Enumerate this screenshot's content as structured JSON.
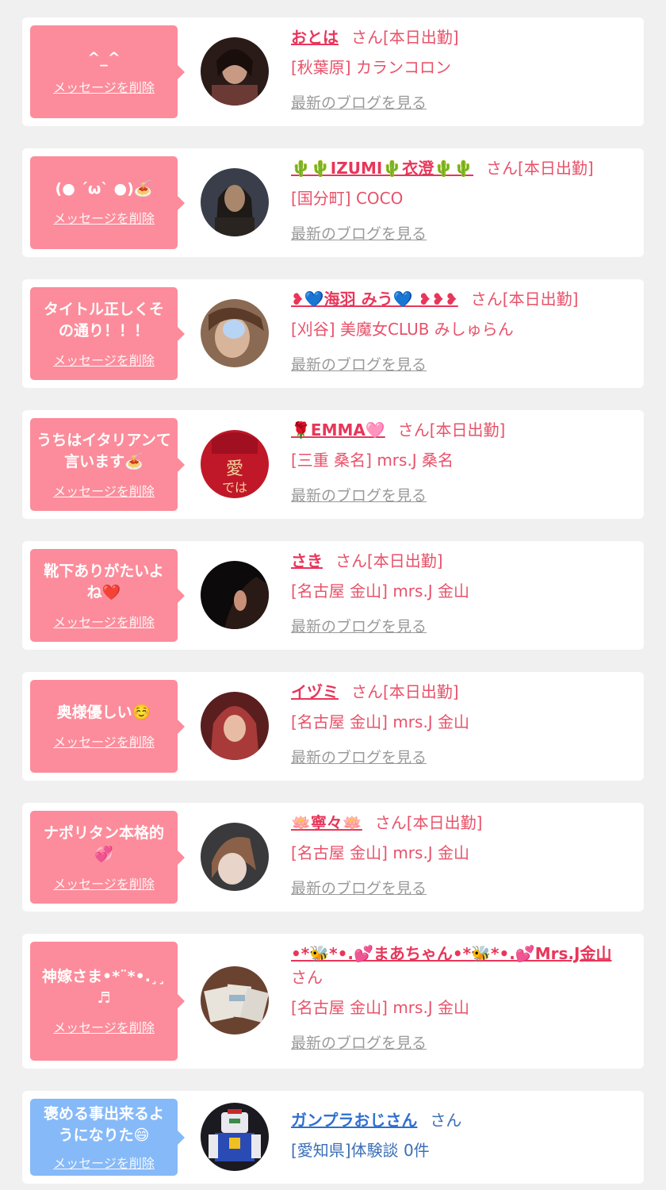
{
  "items": [
    {
      "message": "^_^",
      "delete_label": "メッセージを削除",
      "name": "おとは",
      "suffix": "さん[本日出勤]",
      "shop": "[秋葉原] カランコロン",
      "blog_label": "最新のブログを見る",
      "bubble_color": "#fc8c9b",
      "avatar_colors": [
        "#2a1a18",
        "#c89a84",
        "#6b3a34"
      ]
    },
    {
      "message": "(● ´ω` ●)🍝",
      "delete_label": "メッセージを削除",
      "name": "🌵🌵IZUMI🌵衣澄🌵🌵",
      "suffix": "さん[本日出勤]",
      "shop": "[国分町] COCO",
      "blog_label": "最新のブログを見る",
      "bubble_color": "#fc8c9b",
      "avatar_colors": [
        "#3a3e4a",
        "#a8876c",
        "#1e1a18"
      ]
    },
    {
      "message": "タイトル正しくその通り！！！",
      "delete_label": "メッセージを削除",
      "name": "❥💙海羽 みう💙 ❥❥❥",
      "suffix": "さん[本日出勤]",
      "shop": "[刈谷] 美魔女CLUB みしゅらん",
      "blog_label": "最新のブログを見る",
      "bubble_color": "#fc8c9b",
      "avatar_colors": [
        "#8a6a52",
        "#d8b49a",
        "#b8d4f4"
      ]
    },
    {
      "message": "うちはイタリアンて言います🍝",
      "delete_label": "メッセージを削除",
      "name": "🌹EMMA🩷",
      "suffix": "さん[本日出勤]",
      "shop": "[三重 桑名] mrs.J 桑名",
      "blog_label": "最新のブログを見る",
      "bubble_color": "#fc8c9b",
      "avatar_colors": [
        "#c01828",
        "#e84848",
        "#f4d0a0"
      ]
    },
    {
      "message": "靴下ありがたいよね❤️",
      "delete_label": "メッセージを削除",
      "name": "さき",
      "suffix": "さん[本日出勤]",
      "shop": "[名古屋 金山] mrs.J 金山",
      "blog_label": "最新のブログを見る",
      "bubble_color": "#fc8c9b",
      "avatar_colors": [
        "#0c0a0a",
        "#c89078",
        "#2a1a16"
      ]
    },
    {
      "message": "奥様優しい☺️",
      "delete_label": "メッセージを削除",
      "name": "イヅミ",
      "suffix": "さん[本日出勤]",
      "shop": "[名古屋 金山] mrs.J 金山",
      "blog_label": "最新のブログを見る",
      "bubble_color": "#fc8c9b",
      "avatar_colors": [
        "#5a1e1e",
        "#e8bca4",
        "#a83a3a"
      ]
    },
    {
      "message": "ナポリタン本格的💞",
      "delete_label": "メッセージを削除",
      "name": "🪷寧々🪷",
      "suffix": "さん[本日出勤]",
      "shop": "[名古屋 金山] mrs.J 金山",
      "blog_label": "最新のブログを見る",
      "bubble_color": "#fc8c9b",
      "avatar_colors": [
        "#3a3a3c",
        "#e8d4c8",
        "#8a6048"
      ]
    },
    {
      "message": "神嫁さま•*¨*•.¸¸♬",
      "delete_label": "メッセージを削除",
      "name": "•*🐝*•.💕まあちゃん•*🐝*•.💕Mrs.J金山",
      "suffix": "さん",
      "shop": "[名古屋 金山] mrs.J 金山",
      "blog_label": "最新のブログを見る",
      "bubble_color": "#fc8c9b",
      "avatar_colors": [
        "#6a4230",
        "#e8e4dc",
        "#9ab4c8"
      ]
    },
    {
      "message": "褒める事出来るようになりた😄",
      "delete_label": "メッセージを削除",
      "name": "ガンプラおじさん",
      "suffix": "さん",
      "shop": "[愛知県]体験談 0件",
      "blog_label": "",
      "bubble_color": "#86b9f8",
      "avatar_colors": [
        "#1a1a20",
        "#e8e8ee",
        "#c42a2a"
      ]
    }
  ]
}
